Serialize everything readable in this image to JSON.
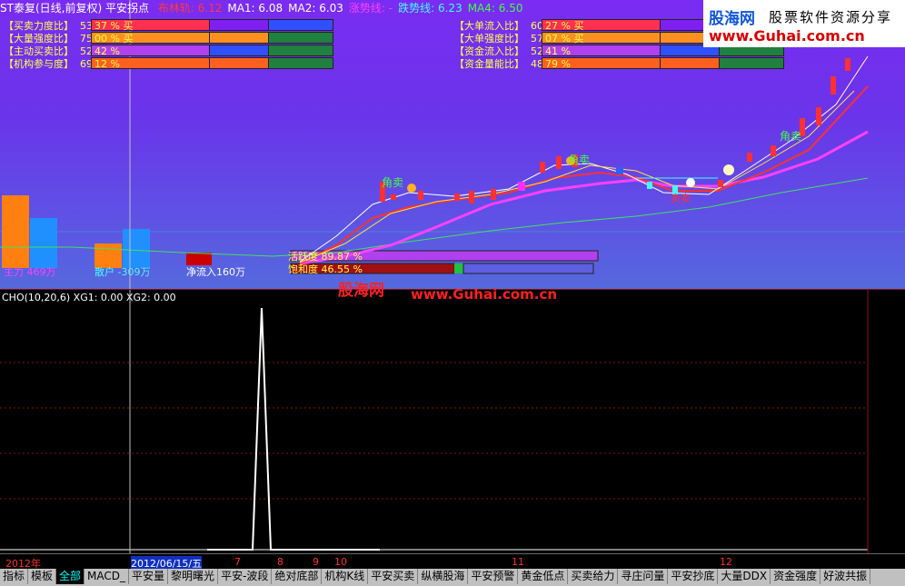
{
  "header": {
    "title": "ST泰复(日线,前复权) 平安拐点",
    "ma_items": [
      {
        "label": "布林轨: 6.12",
        "color": "#ff3a3a"
      },
      {
        "label": "MA1: 6.08",
        "color": "#ffffff"
      },
      {
        "label": "MA2: 6.03",
        "color": "#ffffff"
      },
      {
        "label": "涨势线: -",
        "color": "#ff40ff"
      },
      {
        "label": "跌势线: 6.23",
        "color": "#40ffff"
      },
      {
        "label": "MA4: 6.50",
        "color": "#40ff40"
      }
    ]
  },
  "left_indicators": [
    {
      "label": "【买卖力度比】",
      "value": "53",
      "pct": "37 % 买"
    },
    {
      "label": "【大量强度比】",
      "value": "75",
      "pct": "00 % 买"
    },
    {
      "label": "【主动买卖比】",
      "value": "52",
      "pct": "42 %"
    },
    {
      "label": "【机构参与度】",
      "value": "69",
      "pct": "12 %"
    }
  ],
  "right_indicators": [
    {
      "label": "【大单流入比】",
      "value": "60",
      "pct": "27 % 买"
    },
    {
      "label": "【大单强度比】",
      "value": "57",
      "pct": "07 % 买"
    },
    {
      "label": "【资金流入比】",
      "value": "52",
      "pct": "41 %"
    },
    {
      "label": "【资金量能比】",
      "value": "48",
      "pct": "79 %"
    }
  ],
  "logo": {
    "name": "股海网",
    "tagline": "股票软件资源分享",
    "url": "www.Guhai.com.cn"
  },
  "watermark": {
    "name": "股海网",
    "url": "www.Guhai.com.cn"
  },
  "chart_labels": {
    "sell1": "角卖",
    "sell2": "角卖",
    "sell3": "角卖",
    "sell4": "卖卖",
    "main_force": "主力 469万",
    "retail": "散户 -309万",
    "net_inflow": "净流入160万",
    "activity": "活跃度 89.87 %",
    "saturation": "饱和度 46.55 %"
  },
  "lower_panel": {
    "title": "CHO(10,20,6) XG1: 0.00 XG2: 0.00"
  },
  "xaxis": {
    "labels": [
      "2012年",
      "2012/06/15/五",
      "7",
      "8",
      "9",
      "10",
      "11",
      "12"
    ]
  },
  "tabs": [
    "指标",
    "模板",
    "全部",
    "MACD_",
    "平安量",
    "黎明曙光",
    "平安-波段",
    "绝对底部",
    "机构K线",
    "平安买卖",
    "纵横股海",
    "平安预警",
    "黄金低点",
    "买卖给力",
    "寻庄问量",
    "平安抄底",
    "大量DDX",
    "资金强度",
    "好波共振"
  ],
  "active_tab": "全部",
  "chart_data": {
    "type": "line",
    "title": "CHO(10,20,6) XG1: 0.00 XG2: 0.00",
    "series": [
      {
        "name": "CHO",
        "values": [
          0,
          0,
          0,
          0,
          0,
          0,
          1,
          0,
          0,
          0,
          0,
          0,
          0,
          0,
          0,
          0,
          0,
          0,
          0,
          0
        ]
      }
    ],
    "ylim": [
      0,
      1
    ]
  }
}
